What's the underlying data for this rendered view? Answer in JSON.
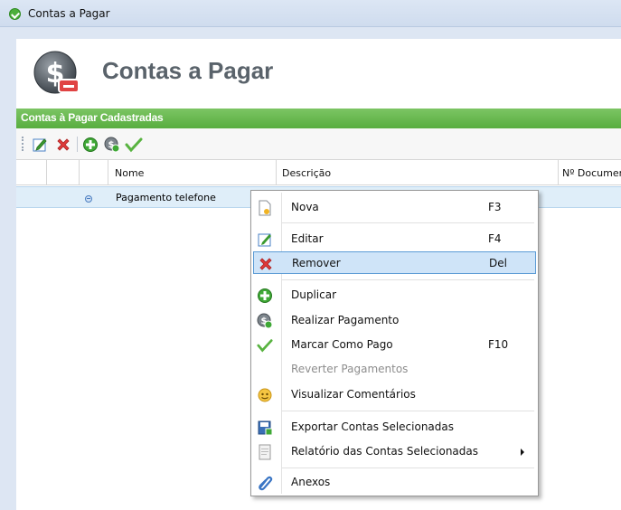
{
  "window": {
    "title": "Contas a Pagar"
  },
  "header": {
    "title": "Contas a Pagar"
  },
  "section": {
    "title": "Contas à Pagar Cadastradas"
  },
  "toolbar": {
    "buttons": [
      "edit-icon",
      "delete-icon",
      "add-icon",
      "payment-icon",
      "check-icon"
    ]
  },
  "grid": {
    "columns": [
      "Nome",
      "Descrição",
      "Nº Documento"
    ],
    "rows": [
      {
        "name": "Pagamento telefone"
      }
    ]
  },
  "context_menu": {
    "items": [
      {
        "label": "Nova",
        "shortcut": "F3",
        "icon": "new-document-icon"
      },
      {
        "label": "Editar",
        "shortcut": "F4",
        "icon": "edit-icon"
      },
      {
        "label": "Remover",
        "shortcut": "Del",
        "icon": "delete-icon",
        "highlighted": true
      },
      {
        "label": "Duplicar",
        "icon": "add-icon"
      },
      {
        "label": "Realizar Pagamento",
        "icon": "payment-icon"
      },
      {
        "label": "Marcar Como Pago",
        "shortcut": "F10",
        "icon": "check-icon"
      },
      {
        "label": "Reverter Pagamentos",
        "disabled": true
      },
      {
        "label": "Visualizar Comentários",
        "icon": "comment-icon"
      },
      {
        "label": "Exportar Contas Selecionadas",
        "icon": "export-icon"
      },
      {
        "label": "Relatório das Contas Selecionadas",
        "icon": "report-icon",
        "submenu": true
      },
      {
        "label": "Anexos",
        "icon": "attachment-icon"
      }
    ]
  },
  "colors": {
    "section_bar": "#5fb346",
    "highlight": "#cfe4f8",
    "frame": "#dde6f3"
  }
}
